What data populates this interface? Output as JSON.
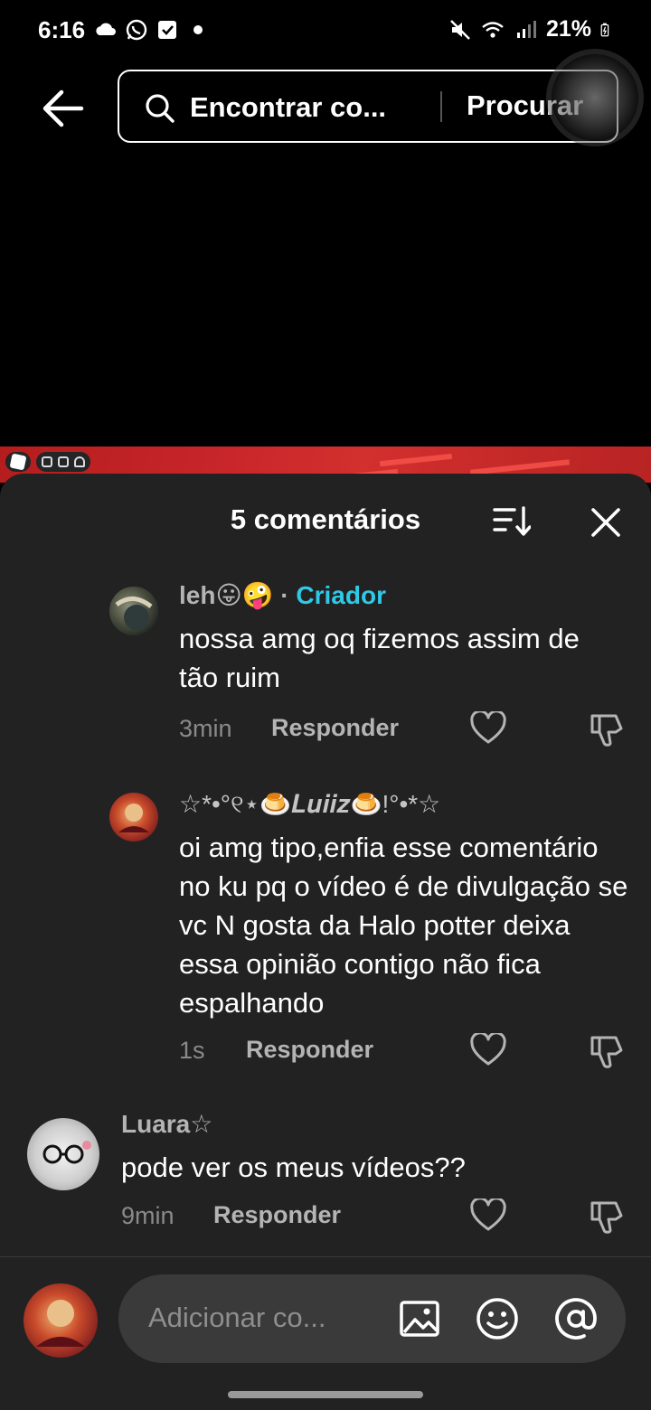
{
  "status_bar": {
    "time": "6:16",
    "battery": "21%",
    "left_icons": [
      "cloud-icon",
      "whatsapp-icon",
      "checkbox-icon",
      "dot-icon"
    ],
    "right_icons": [
      "mute-icon",
      "wifi-icon",
      "signal-icon",
      "battery-icon"
    ]
  },
  "header": {
    "search_placeholder": "Encontrar co...",
    "search_button": "Procurar"
  },
  "panel": {
    "title": "5 comentários"
  },
  "comments": [
    {
      "user": "leh😛🤪",
      "separator": "·",
      "badge": "Criador",
      "text": "nossa amg oq fizemos assim de tão ruim",
      "time": "3min",
      "reply_label": "Responder"
    },
    {
      "user": "☆*•°୧⋆🍮𝑳𝒖𝒊𝒊𝒛🍮!°•*☆",
      "text": "oi amg tipo,enfia esse comentário no ku pq o vídeo é de divulgação se vc N gosta da Halo potter deixa essa opinião contigo não fica espalhando",
      "time": "1s",
      "reply_label": "Responder"
    },
    {
      "user": "Luara☆",
      "text": "pode ver os meus vídeos??",
      "time": "9min",
      "reply_label": "Responder"
    }
  ],
  "composer": {
    "placeholder": "Adicionar co..."
  },
  "colors": {
    "panel_bg": "#222222",
    "creator_badge": "#2fc8e6",
    "composer_bg": "#3a3a3a"
  }
}
